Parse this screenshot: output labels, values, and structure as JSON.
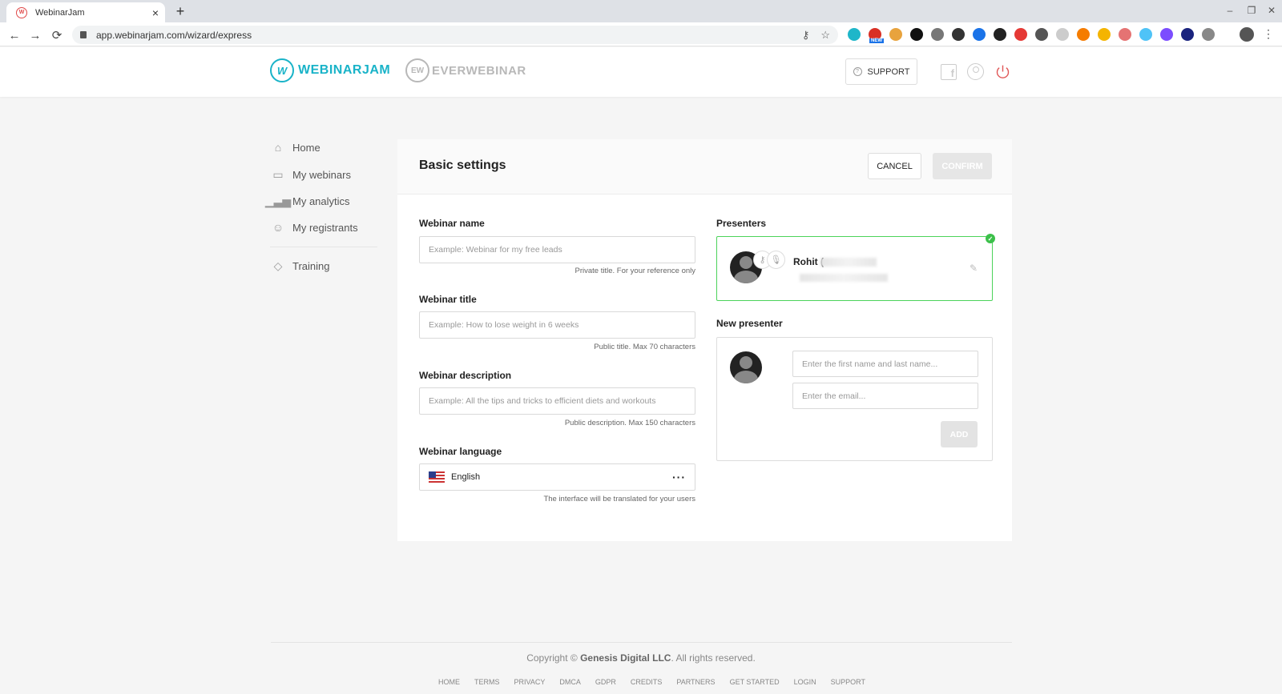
{
  "browser": {
    "tab_title": "WebinarJam",
    "tab_close": "×",
    "new_tab": "+",
    "url": "app.webinarjam.com/wizard/express",
    "window_controls": [
      "–",
      "❐",
      "✕"
    ],
    "extension_colors": [
      "#1fb6c9",
      "#d93025",
      "#e8a33d",
      "#111111",
      "#777777",
      "#333333",
      "#1a73e8",
      "#222222",
      "#e53935",
      "#555555",
      "#cccccc",
      "#f57c00",
      "#f4b400",
      "#e57373",
      "#4fc3f7",
      "#7c4dff",
      "#1a237e",
      "#888888"
    ],
    "extension_badge": "NEW"
  },
  "header": {
    "brand_primary": "WEBINARJAM",
    "brand_secondary": "EVERWEBINAR",
    "support_label": "SUPPORT",
    "brand_color": "#19b3c8"
  },
  "sidebar": {
    "items": [
      {
        "label": "Home",
        "icon": "home-icon"
      },
      {
        "label": "My webinars",
        "icon": "webinars-icon"
      },
      {
        "label": "My analytics",
        "icon": "analytics-icon"
      },
      {
        "label": "My registrants",
        "icon": "registrants-icon"
      },
      {
        "label": "Training",
        "icon": "training-icon"
      }
    ]
  },
  "card": {
    "title": "Basic settings",
    "cancel_label": "CANCEL",
    "confirm_label": "CONFIRM"
  },
  "form": {
    "name": {
      "label": "Webinar name",
      "placeholder": "Example: Webinar for my free leads",
      "hint": "Private title. For your reference only"
    },
    "title": {
      "label": "Webinar title",
      "placeholder": "Example: How to lose weight in 6 weeks",
      "hint": "Public title. Max 70 characters"
    },
    "description": {
      "label": "Webinar description",
      "placeholder": "Example: All the tips and tricks to efficient diets and workouts",
      "hint": "Public description. Max 150 characters"
    },
    "language": {
      "label": "Webinar language",
      "value": "English",
      "hint": "The interface will be translated for your users"
    }
  },
  "presenters": {
    "label": "Presenters",
    "items": [
      {
        "name": "Rohit ("
      }
    ],
    "active_color": "#4cd35a"
  },
  "new_presenter": {
    "label": "New presenter",
    "name_placeholder": "Enter the first name and last name...",
    "email_placeholder": "Enter the email...",
    "add_label": "ADD"
  },
  "footer": {
    "copyright_prefix": "Copyright ©",
    "company": "Genesis Digital LLC",
    "copyright_suffix": ". All rights reserved.",
    "links": [
      "HOME",
      "TERMS",
      "PRIVACY",
      "DMCA",
      "GDPR",
      "CREDITS",
      "PARTNERS",
      "GET STARTED",
      "LOGIN",
      "SUPPORT"
    ]
  }
}
